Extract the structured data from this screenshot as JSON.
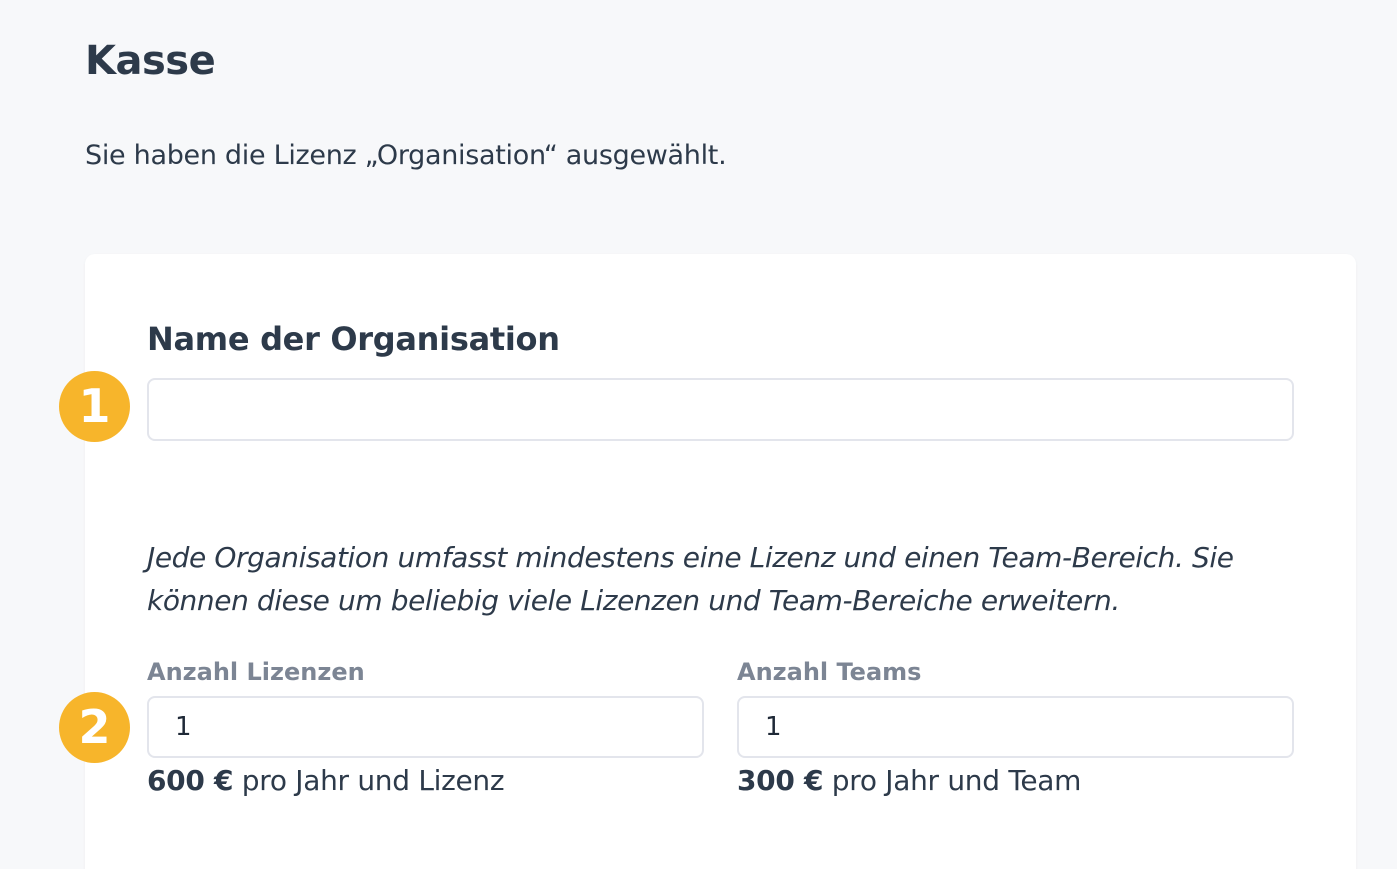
{
  "header": {
    "title": "Kasse",
    "intro": "Sie haben die Lizenz „Organisation“ ausgewählt."
  },
  "form": {
    "org_name": {
      "label": "Name der Organisation",
      "value": "",
      "marker": "1"
    },
    "hint": "Jede Organisation umfasst mindestens eine Lizenz und einen Team-Bereich. Sie können diese um beliebig viele Lizenzen und Team-Bereiche erweitern.",
    "quantity_marker": "2",
    "licenses": {
      "label": "Anzahl Lizenzen",
      "value": "1",
      "price": "600 €",
      "price_suffix": " pro Jahr und Lizenz"
    },
    "teams": {
      "label": "Anzahl Teams",
      "value": "1",
      "price": "300 €",
      "price_suffix": " pro Jahr und Team"
    }
  },
  "colors": {
    "background": "#f7f8fa",
    "card": "#ffffff",
    "marker": "#f7b52b",
    "text": "#2d3a4a",
    "muted_label": "#7c8594",
    "input_border": "#e3e5ec"
  }
}
